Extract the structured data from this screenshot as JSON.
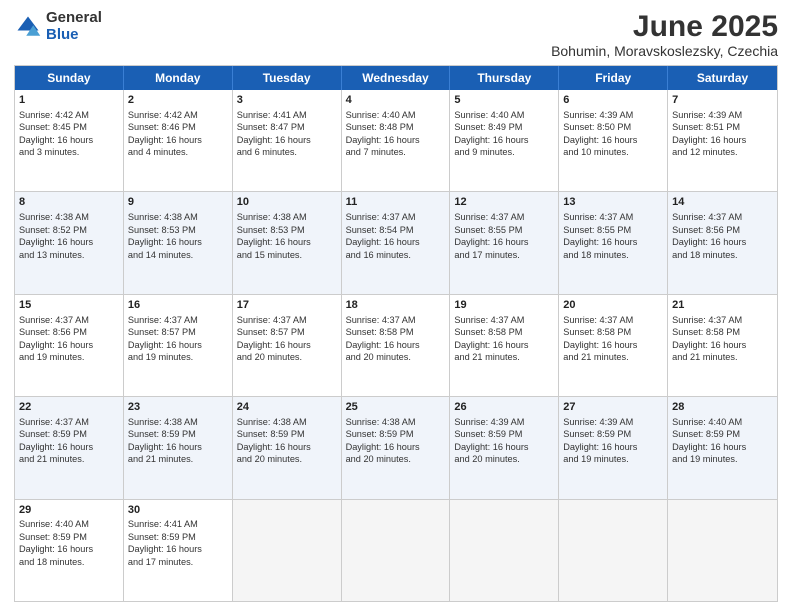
{
  "logo": {
    "general": "General",
    "blue": "Blue"
  },
  "title": "June 2025",
  "subtitle": "Bohumin, Moravskoslezsky, Czechia",
  "header_days": [
    "Sunday",
    "Monday",
    "Tuesday",
    "Wednesday",
    "Thursday",
    "Friday",
    "Saturday"
  ],
  "weeks": [
    [
      {
        "day": "1",
        "lines": [
          "Sunrise: 4:42 AM",
          "Sunset: 8:45 PM",
          "Daylight: 16 hours",
          "and 3 minutes."
        ]
      },
      {
        "day": "2",
        "lines": [
          "Sunrise: 4:42 AM",
          "Sunset: 8:46 PM",
          "Daylight: 16 hours",
          "and 4 minutes."
        ]
      },
      {
        "day": "3",
        "lines": [
          "Sunrise: 4:41 AM",
          "Sunset: 8:47 PM",
          "Daylight: 16 hours",
          "and 6 minutes."
        ]
      },
      {
        "day": "4",
        "lines": [
          "Sunrise: 4:40 AM",
          "Sunset: 8:48 PM",
          "Daylight: 16 hours",
          "and 7 minutes."
        ]
      },
      {
        "day": "5",
        "lines": [
          "Sunrise: 4:40 AM",
          "Sunset: 8:49 PM",
          "Daylight: 16 hours",
          "and 9 minutes."
        ]
      },
      {
        "day": "6",
        "lines": [
          "Sunrise: 4:39 AM",
          "Sunset: 8:50 PM",
          "Daylight: 16 hours",
          "and 10 minutes."
        ]
      },
      {
        "day": "7",
        "lines": [
          "Sunrise: 4:39 AM",
          "Sunset: 8:51 PM",
          "Daylight: 16 hours",
          "and 12 minutes."
        ]
      }
    ],
    [
      {
        "day": "8",
        "lines": [
          "Sunrise: 4:38 AM",
          "Sunset: 8:52 PM",
          "Daylight: 16 hours",
          "and 13 minutes."
        ]
      },
      {
        "day": "9",
        "lines": [
          "Sunrise: 4:38 AM",
          "Sunset: 8:53 PM",
          "Daylight: 16 hours",
          "and 14 minutes."
        ]
      },
      {
        "day": "10",
        "lines": [
          "Sunrise: 4:38 AM",
          "Sunset: 8:53 PM",
          "Daylight: 16 hours",
          "and 15 minutes."
        ]
      },
      {
        "day": "11",
        "lines": [
          "Sunrise: 4:37 AM",
          "Sunset: 8:54 PM",
          "Daylight: 16 hours",
          "and 16 minutes."
        ]
      },
      {
        "day": "12",
        "lines": [
          "Sunrise: 4:37 AM",
          "Sunset: 8:55 PM",
          "Daylight: 16 hours",
          "and 17 minutes."
        ]
      },
      {
        "day": "13",
        "lines": [
          "Sunrise: 4:37 AM",
          "Sunset: 8:55 PM",
          "Daylight: 16 hours",
          "and 18 minutes."
        ]
      },
      {
        "day": "14",
        "lines": [
          "Sunrise: 4:37 AM",
          "Sunset: 8:56 PM",
          "Daylight: 16 hours",
          "and 18 minutes."
        ]
      }
    ],
    [
      {
        "day": "15",
        "lines": [
          "Sunrise: 4:37 AM",
          "Sunset: 8:56 PM",
          "Daylight: 16 hours",
          "and 19 minutes."
        ]
      },
      {
        "day": "16",
        "lines": [
          "Sunrise: 4:37 AM",
          "Sunset: 8:57 PM",
          "Daylight: 16 hours",
          "and 19 minutes."
        ]
      },
      {
        "day": "17",
        "lines": [
          "Sunrise: 4:37 AM",
          "Sunset: 8:57 PM",
          "Daylight: 16 hours",
          "and 20 minutes."
        ]
      },
      {
        "day": "18",
        "lines": [
          "Sunrise: 4:37 AM",
          "Sunset: 8:58 PM",
          "Daylight: 16 hours",
          "and 20 minutes."
        ]
      },
      {
        "day": "19",
        "lines": [
          "Sunrise: 4:37 AM",
          "Sunset: 8:58 PM",
          "Daylight: 16 hours",
          "and 21 minutes."
        ]
      },
      {
        "day": "20",
        "lines": [
          "Sunrise: 4:37 AM",
          "Sunset: 8:58 PM",
          "Daylight: 16 hours",
          "and 21 minutes."
        ]
      },
      {
        "day": "21",
        "lines": [
          "Sunrise: 4:37 AM",
          "Sunset: 8:58 PM",
          "Daylight: 16 hours",
          "and 21 minutes."
        ]
      }
    ],
    [
      {
        "day": "22",
        "lines": [
          "Sunrise: 4:37 AM",
          "Sunset: 8:59 PM",
          "Daylight: 16 hours",
          "and 21 minutes."
        ]
      },
      {
        "day": "23",
        "lines": [
          "Sunrise: 4:38 AM",
          "Sunset: 8:59 PM",
          "Daylight: 16 hours",
          "and 21 minutes."
        ]
      },
      {
        "day": "24",
        "lines": [
          "Sunrise: 4:38 AM",
          "Sunset: 8:59 PM",
          "Daylight: 16 hours",
          "and 20 minutes."
        ]
      },
      {
        "day": "25",
        "lines": [
          "Sunrise: 4:38 AM",
          "Sunset: 8:59 PM",
          "Daylight: 16 hours",
          "and 20 minutes."
        ]
      },
      {
        "day": "26",
        "lines": [
          "Sunrise: 4:39 AM",
          "Sunset: 8:59 PM",
          "Daylight: 16 hours",
          "and 20 minutes."
        ]
      },
      {
        "day": "27",
        "lines": [
          "Sunrise: 4:39 AM",
          "Sunset: 8:59 PM",
          "Daylight: 16 hours",
          "and 19 minutes."
        ]
      },
      {
        "day": "28",
        "lines": [
          "Sunrise: 4:40 AM",
          "Sunset: 8:59 PM",
          "Daylight: 16 hours",
          "and 19 minutes."
        ]
      }
    ],
    [
      {
        "day": "29",
        "lines": [
          "Sunrise: 4:40 AM",
          "Sunset: 8:59 PM",
          "Daylight: 16 hours",
          "and 18 minutes."
        ]
      },
      {
        "day": "30",
        "lines": [
          "Sunrise: 4:41 AM",
          "Sunset: 8:59 PM",
          "Daylight: 16 hours",
          "and 17 minutes."
        ]
      },
      {
        "day": "",
        "lines": []
      },
      {
        "day": "",
        "lines": []
      },
      {
        "day": "",
        "lines": []
      },
      {
        "day": "",
        "lines": []
      },
      {
        "day": "",
        "lines": []
      }
    ]
  ]
}
